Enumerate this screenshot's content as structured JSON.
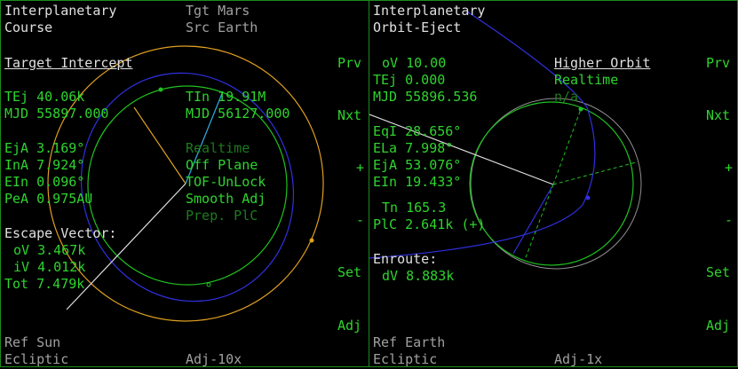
{
  "left": {
    "title1": "Interplanetary",
    "title2": "Course",
    "tgt": "Tgt Mars",
    "src": "Src Earth",
    "section": "Target Intercept",
    "tej": "TEj 40.06k",
    "mjd": "MJD 55897.000",
    "tin": "TIn 19.91M",
    "mjd2": "MJD 56127.000",
    "eja": "EjA 3.169°",
    "ina": "InA 7.924°",
    "ein": "EIn 0.096°",
    "pea": "PeA 0.975AU",
    "opt_realtime": "Realtime",
    "opt_offplane": "Off Plane",
    "opt_tof": "TOF-UnLock",
    "opt_smooth": "Smooth Adj",
    "opt_prep": "Prep. PlC",
    "escape": "Escape Vector:",
    "ov": "oV 3.467k",
    "iv": "iV 4.012k",
    "tot": "Tot 7.479k",
    "ref": "Ref Sun",
    "frame": "Ecliptic",
    "adj": "Adj-10x",
    "btn_prv": "Prv",
    "btn_nxt": "Nxt",
    "btn_plus": "+",
    "btn_minus": "-",
    "btn_set": "Set",
    "btn_adj": "Adj"
  },
  "right": {
    "title1": "Interplanetary",
    "title2": "Orbit-Eject",
    "ov": "oV 10.00",
    "tej": "TEj 0.000",
    "mjd": "MJD 55896.536",
    "mode": "Higher Orbit",
    "realtime": "Realtime",
    "na": "n/a",
    "eqi": "EqI 28.656°",
    "ela": "ELa 7.998°",
    "eja": "EjA 53.076°",
    "ein": "EIn 19.433°",
    "tn": "Tn 165.3",
    "plc": "PlC 2.641k (+)",
    "enroute": "Enroute:",
    "dv": "dV 8.883k",
    "ref": "Ref Earth",
    "frame": "Ecliptic",
    "adj": "Adj-1x",
    "btn_prv": "Prv",
    "btn_nxt": "Nxt",
    "btn_plus": "+",
    "btn_minus": "-",
    "btn_set": "Set",
    "btn_adj": "Adj"
  },
  "colors": {
    "text_white": "#e0e0e0",
    "text_green": "#2ed42e",
    "text_gray": "#a0a0a0",
    "text_dim": "#1e7a1e",
    "orbit_target": "#e0a020",
    "orbit_course": "#3030e0",
    "orbit_source": "#20c020",
    "border": "#1c8a1c"
  }
}
